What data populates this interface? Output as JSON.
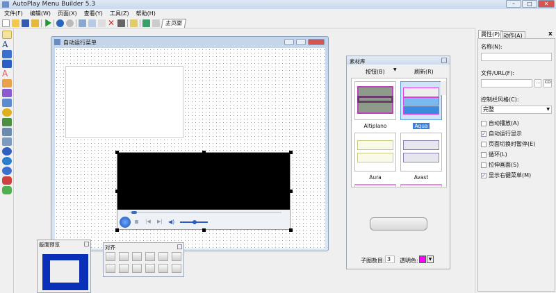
{
  "app": {
    "title": "AutoPlay Menu Builder 5.3"
  },
  "menu": [
    "文件(F)",
    "编辑(W)",
    "页面(X)",
    "查看(Y)",
    "工具(Z)",
    "帮助(H)"
  ],
  "toolbar": {
    "page_tab": "主页面"
  },
  "designer": {
    "title": "自动运行菜单"
  },
  "library": {
    "title": "素材库",
    "category": "按钮(B)",
    "refresh": "刷新(R)",
    "items": [
      "Altiplano",
      "Aqua",
      "Aura",
      "Avast"
    ],
    "selected": "Aqua",
    "sub_count_label": "子图数目:",
    "sub_count": "3",
    "transparent_label": "透明色:",
    "transparent_color": "#ff00ff"
  },
  "preview": {
    "title": "版面预览"
  },
  "align": {
    "title": "对齐"
  },
  "props": {
    "tabs": [
      "属性(P)",
      "动作(A)"
    ],
    "name_label": "名称(N):",
    "name_value": "",
    "file_label": "文件/URL(F):",
    "file_value": "",
    "control_style_label": "控制栏风格(C):",
    "control_style_value": "完整",
    "checkboxes": [
      {
        "label": "自动播放(A)",
        "checked": false
      },
      {
        "label": "自动运行显示",
        "checked": true
      },
      {
        "label": "页面切换时暂停(E)",
        "checked": false
      },
      {
        "label": "循环(L)",
        "checked": false
      },
      {
        "label": "拉伸画面(S)",
        "checked": false
      },
      {
        "label": "显示右键菜单(M)",
        "checked": true
      }
    ]
  }
}
